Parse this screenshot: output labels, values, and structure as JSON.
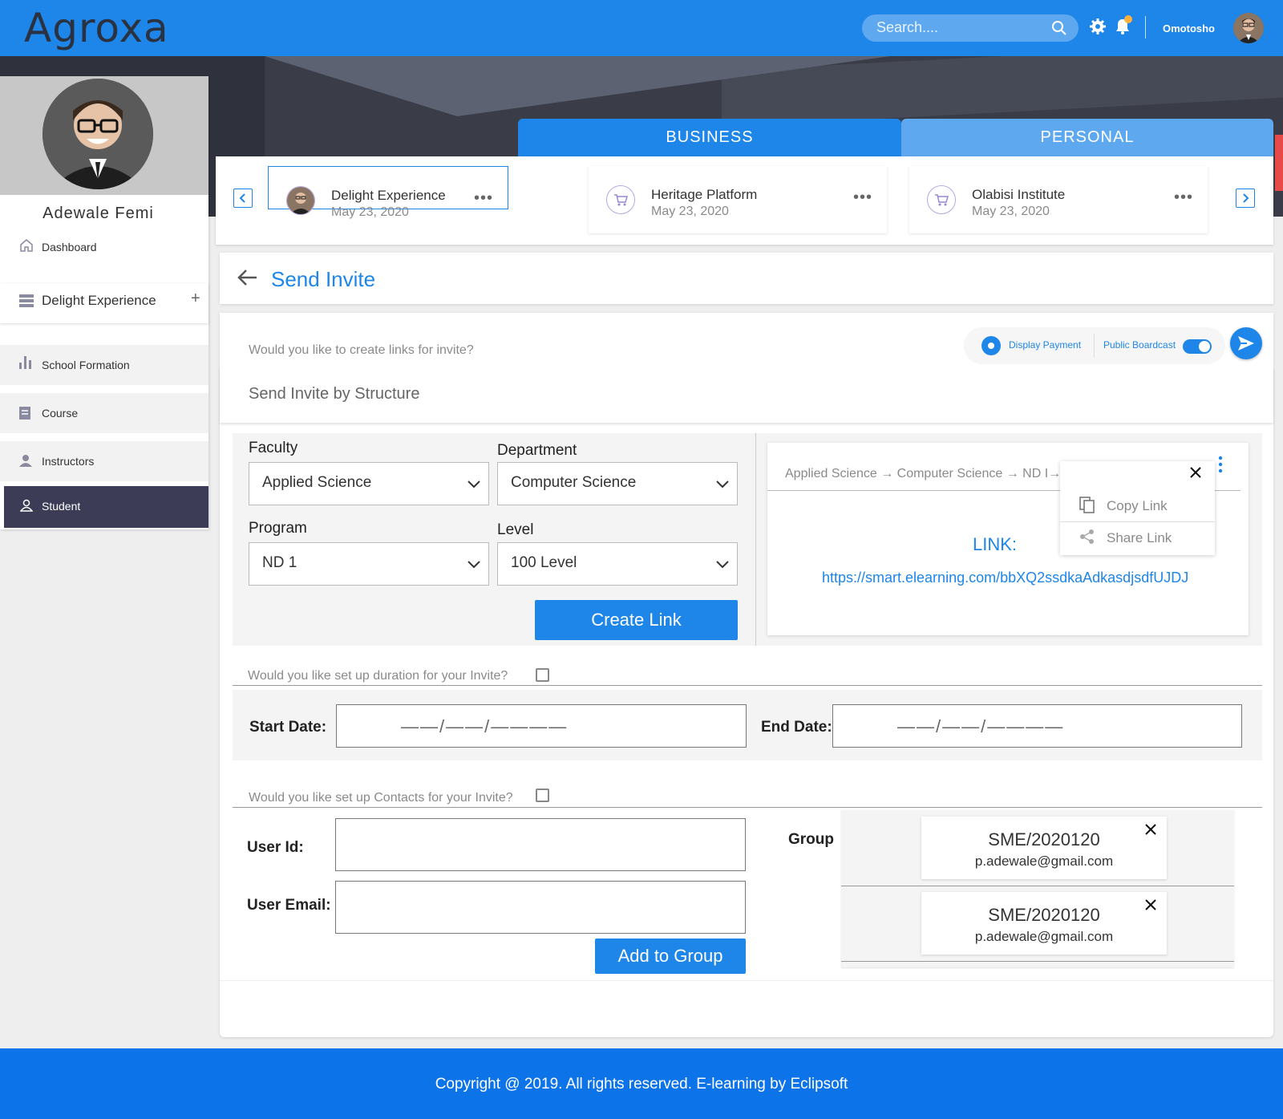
{
  "app": {
    "logo": "Agroxa"
  },
  "topbar": {
    "search_placeholder": "Search....",
    "user_name": "Omotosho",
    "icons": [
      "search-icon",
      "gear-icon",
      "bell-icon"
    ],
    "notification_dot_color": "#ffb13b"
  },
  "tabs": [
    {
      "label": "BUSINESS",
      "active": true
    },
    {
      "label": "PERSONAL",
      "active": false
    }
  ],
  "sidebar": {
    "profile_name": "Adewale Femi",
    "items": [
      {
        "label": "Dashboard",
        "icon": "home-icon"
      },
      {
        "label": "Delight Experience",
        "icon": "list-icon",
        "action": "+"
      },
      {
        "label": "School Formation",
        "icon": "bar-chart-icon"
      },
      {
        "label": "Course",
        "icon": "document-icon"
      },
      {
        "label": "Instructors",
        "icon": "person-icon"
      },
      {
        "label": "Student",
        "icon": "person-outline-icon",
        "active": true
      }
    ]
  },
  "cards": [
    {
      "title": "Delight Experience",
      "date": "May 23, 2020",
      "icon": "avatar",
      "selected": true,
      "menu": "•••"
    },
    {
      "title": "Heritage Platform",
      "date": "May 23, 2020",
      "icon": "cart-icon",
      "menu": "•••"
    },
    {
      "title": "Olabisi Institute",
      "date": "May 23, 2020",
      "icon": "cart-icon",
      "menu": "•••"
    }
  ],
  "page": {
    "title": "Send Invite",
    "links_question": "Would  you like to create links for invite?",
    "options": {
      "display_payment": "Display Payment",
      "public_broadcast": "Public Boardcast",
      "public_broadcast_on": true
    },
    "structure_title": "Send Invite by Structure"
  },
  "form": {
    "faculty": {
      "label": "Faculty",
      "value": "Applied Science"
    },
    "department": {
      "label": "Department",
      "value": "Computer Science"
    },
    "program": {
      "label": "Program",
      "value": "ND 1"
    },
    "level": {
      "label": "Level",
      "value": "100 Level"
    },
    "create_link_label": "Create Link"
  },
  "link_panel": {
    "breadcrumb": "Applied Science → Computer Science → ND I→",
    "menu": {
      "copy": "Copy Link",
      "share": "Share Link"
    },
    "link_label": "LINK:",
    "link_url": "https://smart.elearning.com/bbXQ2ssdkaAdkasdjsdfUJDJ"
  },
  "duration": {
    "question": "Would  you like set up duration for your Invite?",
    "checked": false,
    "start_label": "Start Date:",
    "end_label": "End Date:",
    "date_placeholder": "——/——/————"
  },
  "contacts": {
    "question": "Would  you like set up Contacts for your Invite?",
    "checked": false,
    "user_id_label": "User Id:",
    "user_email_label": "User Email:",
    "add_button": "Add to Group",
    "group_label": "Group",
    "group": [
      {
        "id": "SME/2020120",
        "email": "p.adewale@gmail.com"
      },
      {
        "id": "SME/2020120",
        "email": "p.adewale@gmail.com"
      }
    ]
  },
  "footer": {
    "text": "Copyright @ 2019. All rights reserved. E-learning by Eclipsoft"
  },
  "colors": {
    "primary": "#1e86e8",
    "sidebar_active": "#3d3c57",
    "footer": "#0c73e8"
  }
}
